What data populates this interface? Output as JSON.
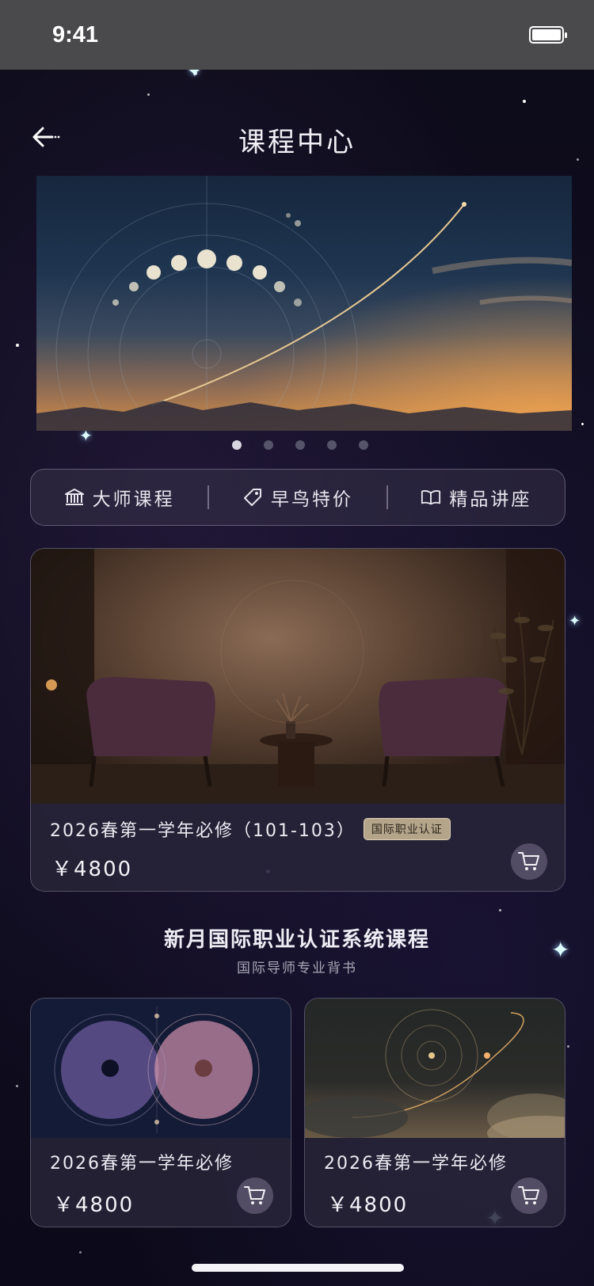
{
  "status_bar": {
    "time": "9:41"
  },
  "nav": {
    "title": "课程中心",
    "back_icon": "arrow-left-icon"
  },
  "banner": {
    "slides_count": 5,
    "active_index": 0
  },
  "categories": [
    {
      "label": "大师课程",
      "icon": "institution-icon"
    },
    {
      "label": "早鸟特价",
      "icon": "price-tag-icon"
    },
    {
      "label": "精品讲座",
      "icon": "open-book-icon"
    }
  ],
  "featured": {
    "title": "2026春第一学年必修（101-103）",
    "badge": "国际职业认证",
    "price": "￥4800",
    "cart_icon": "cart-icon"
  },
  "section": {
    "title": "新月国际职业认证系统课程",
    "subtitle": "国际导师专业背书"
  },
  "cards": [
    {
      "title": "2026春第一学年必修",
      "price": "￥4800"
    },
    {
      "title": "2026春第一学年必修",
      "price": "￥4800"
    }
  ],
  "colors": {
    "background": "#0c0b18",
    "badge": "#b3a48a",
    "status_bar": "#4a4a4c"
  }
}
